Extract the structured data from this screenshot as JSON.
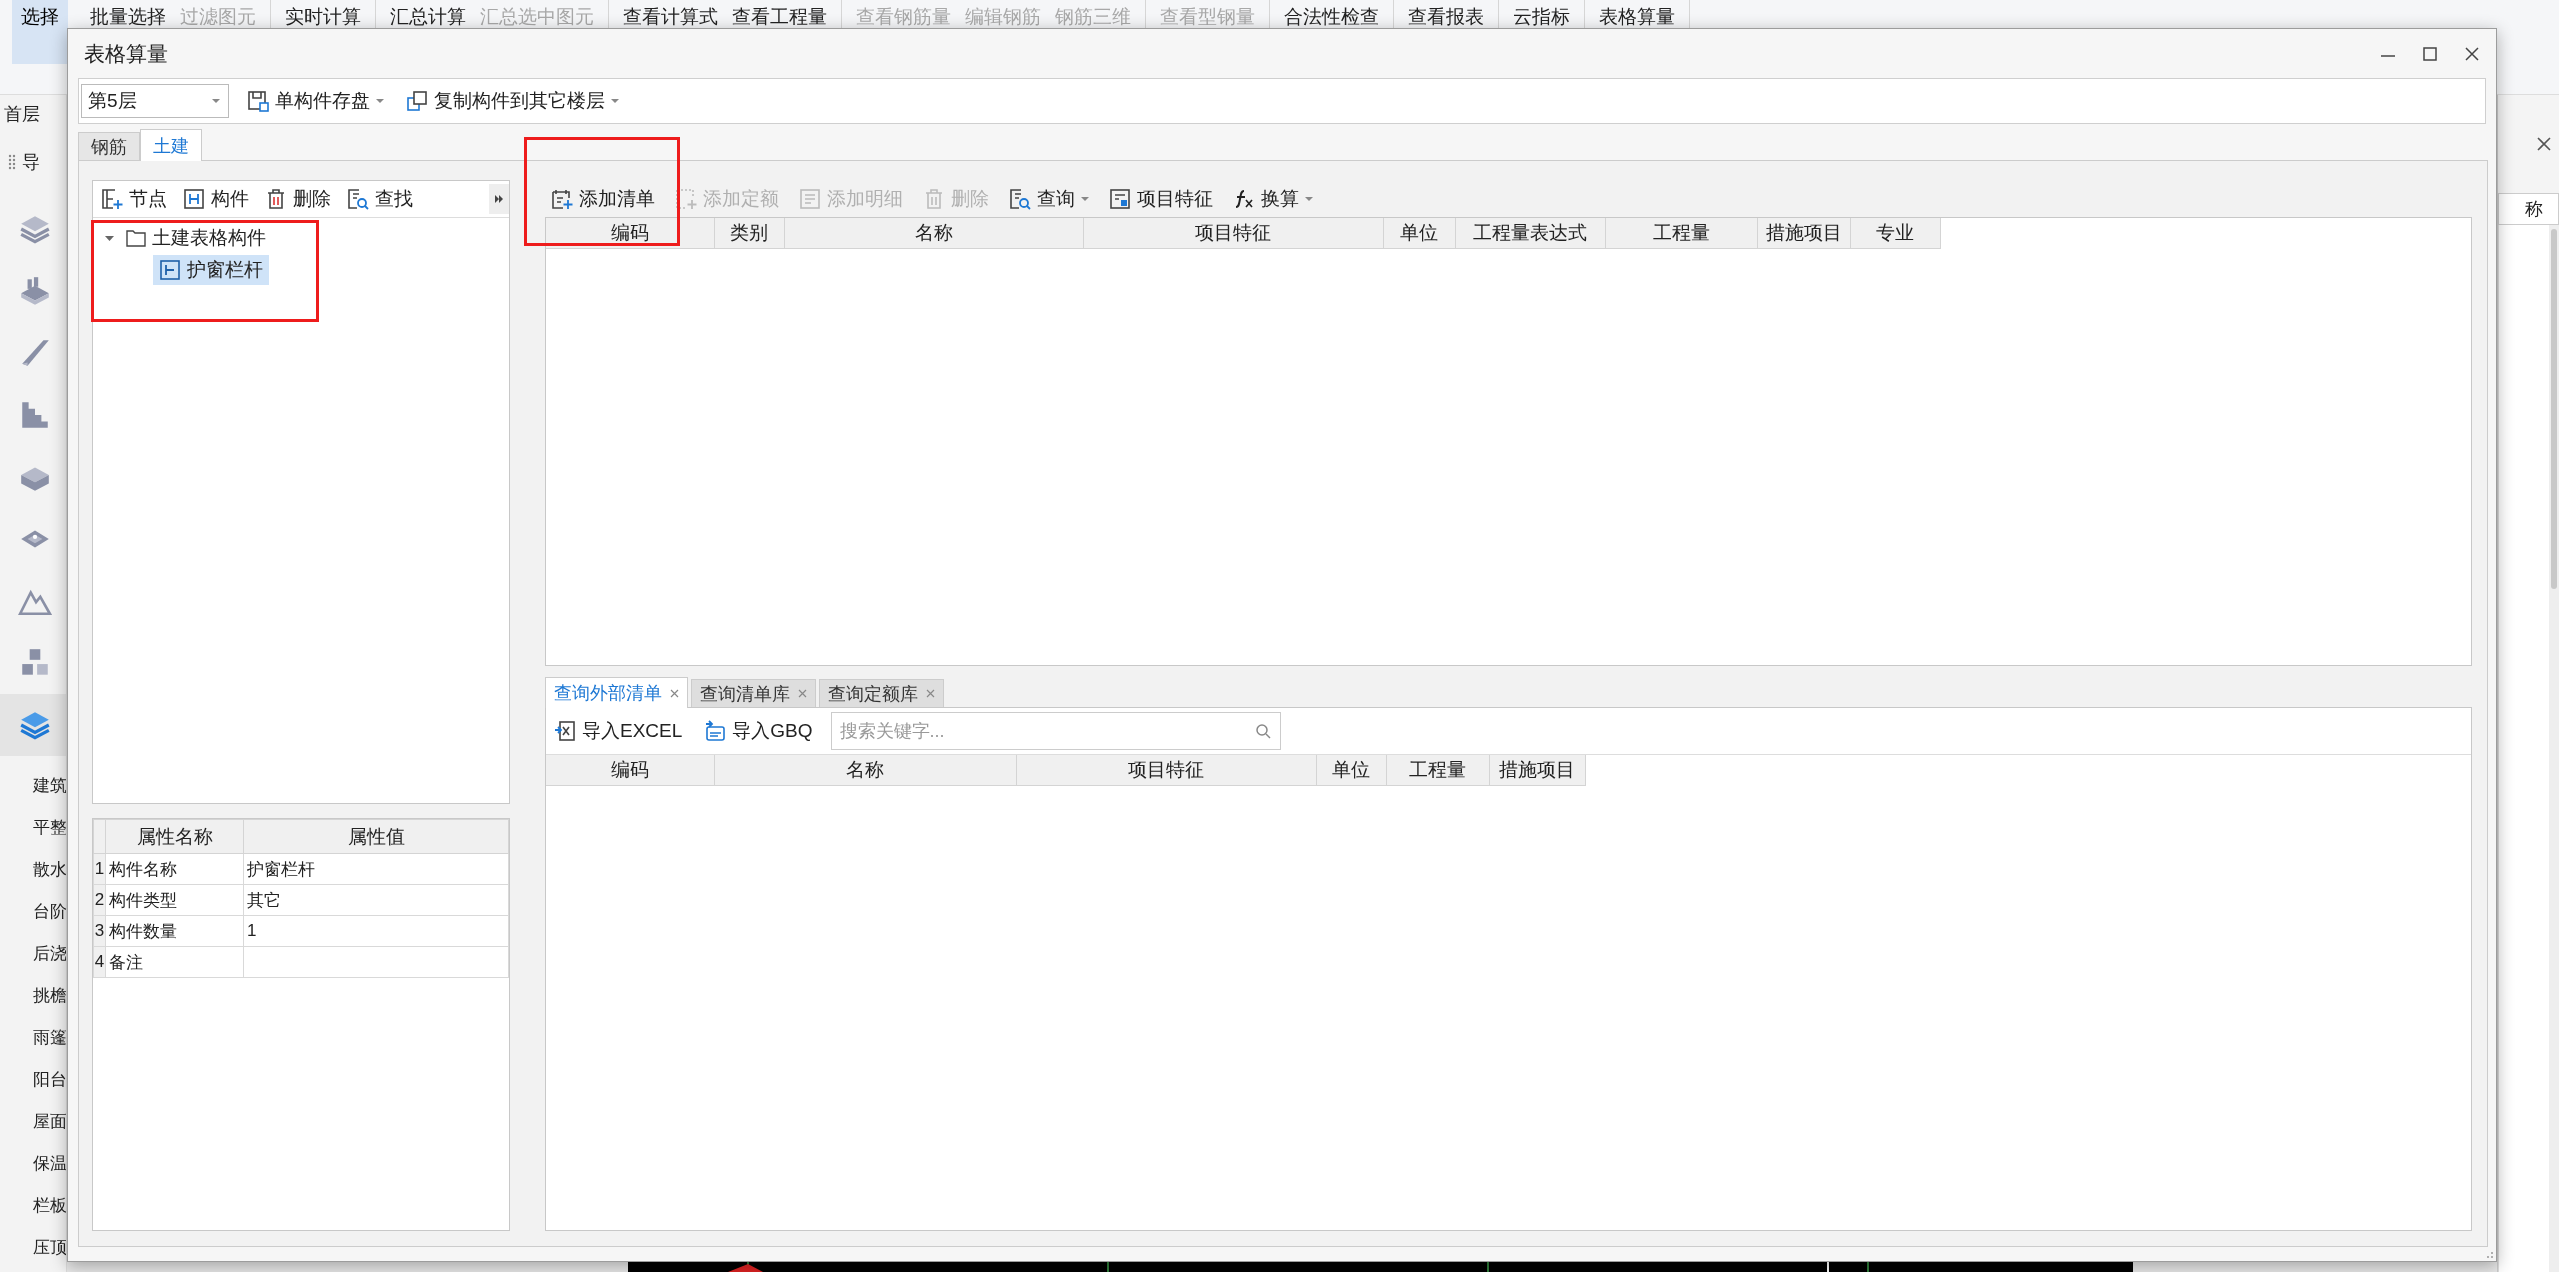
{
  "ribbon": {
    "select_button": "选择",
    "groups": [
      {
        "items": [
          {
            "label": "批量选择",
            "disabled": false
          },
          {
            "label": "过滤图元",
            "disabled": true
          }
        ]
      },
      {
        "items": [
          {
            "label": "实时计算",
            "disabled": false
          }
        ]
      },
      {
        "items": [
          {
            "label": "汇总计算",
            "disabled": false
          },
          {
            "label": "汇总选中图元",
            "disabled": true
          }
        ]
      },
      {
        "items": [
          {
            "label": "查看计算式",
            "disabled": false
          },
          {
            "label": "查看工程量",
            "disabled": false
          }
        ]
      },
      {
        "items": [
          {
            "label": "查看钢筋量",
            "disabled": true
          },
          {
            "label": "编辑钢筋",
            "disabled": true
          },
          {
            "label": "钢筋三维",
            "disabled": true
          }
        ]
      },
      {
        "items": [
          {
            "label": "查看型钢量",
            "disabled": true
          }
        ]
      },
      {
        "items": [
          {
            "label": "合法性检查",
            "disabled": false
          }
        ]
      },
      {
        "items": [
          {
            "label": "查看报表",
            "disabled": false
          }
        ]
      },
      {
        "items": [
          {
            "label": "云指标",
            "disabled": false
          }
        ]
      },
      {
        "items": [
          {
            "label": "表格算量",
            "disabled": false
          }
        ]
      }
    ]
  },
  "nav": {
    "floor": "首层",
    "title": "导",
    "icons": [
      {
        "selected": false
      },
      {
        "selected": false
      },
      {
        "selected": false
      },
      {
        "selected": false
      },
      {
        "selected": false
      },
      {
        "selected": false
      },
      {
        "selected": false
      },
      {
        "selected": false
      },
      {
        "selected": true
      }
    ],
    "categories": [
      "建筑",
      "平整",
      "散水",
      "台阶",
      "后浇",
      "挑檐",
      "雨篷",
      "阳台",
      "屋面",
      "保温",
      "栏板",
      "压顶"
    ]
  },
  "side_panel": {
    "column_label": "称"
  },
  "dialog": {
    "title": "表格算量",
    "floor_select": "第5层",
    "toolbar": [
      {
        "label": "单构件存盘"
      },
      {
        "label": "复制构件到其它楼层"
      }
    ],
    "tabs": [
      {
        "label": "钢筋",
        "selected": false
      },
      {
        "label": "土建",
        "selected": true
      }
    ],
    "tree_toolbar": [
      {
        "label": "节点"
      },
      {
        "label": "构件"
      },
      {
        "label": "删除"
      },
      {
        "label": "查找"
      }
    ],
    "tree": [
      {
        "label": "土建表格构件",
        "expanded": true,
        "selected": false,
        "children": [
          {
            "label": "护窗栏杆",
            "selected": true
          }
        ]
      }
    ],
    "properties": {
      "columns": [
        "属性名称",
        "属性值"
      ],
      "rows": [
        {
          "index": "1",
          "name": "构件名称",
          "value": "护窗栏杆"
        },
        {
          "index": "2",
          "name": "构件类型",
          "value": "其它"
        },
        {
          "index": "3",
          "name": "构件数量",
          "value": "1"
        },
        {
          "index": "4",
          "name": "备注"
        }
      ]
    },
    "list_toolbar": [
      {
        "label": "添加清单",
        "disabled": false,
        "dropdown": false
      },
      {
        "label": "添加定额",
        "disabled": true,
        "dropdown": false
      },
      {
        "label": "添加明细",
        "disabled": true,
        "dropdown": false
      },
      {
        "label": "删除",
        "disabled": true,
        "dropdown": false
      },
      {
        "label": "查询",
        "disabled": false,
        "dropdown": true
      },
      {
        "label": "项目特征",
        "disabled": false,
        "dropdown": false
      },
      {
        "label": "换算",
        "disabled": false,
        "dropdown": true
      }
    ],
    "list_columns": [
      "编码",
      "类别",
      "名称",
      "项目特征",
      "单位",
      "工程量表达式",
      "工程量",
      "措施项目",
      "专业"
    ],
    "bottom_tabs": [
      {
        "label": "查询外部清单",
        "selected": true
      },
      {
        "label": "查询清单库",
        "selected": false
      },
      {
        "label": "查询定额库",
        "selected": false
      }
    ],
    "import_buttons": [
      {
        "label": "导入EXCEL"
      },
      {
        "label": "导入GBQ"
      }
    ],
    "search": {
      "placeholder": "搜索关键字..."
    },
    "query_columns": [
      "编码",
      "名称",
      "项目特征",
      "单位",
      "工程量",
      "措施项目"
    ]
  }
}
